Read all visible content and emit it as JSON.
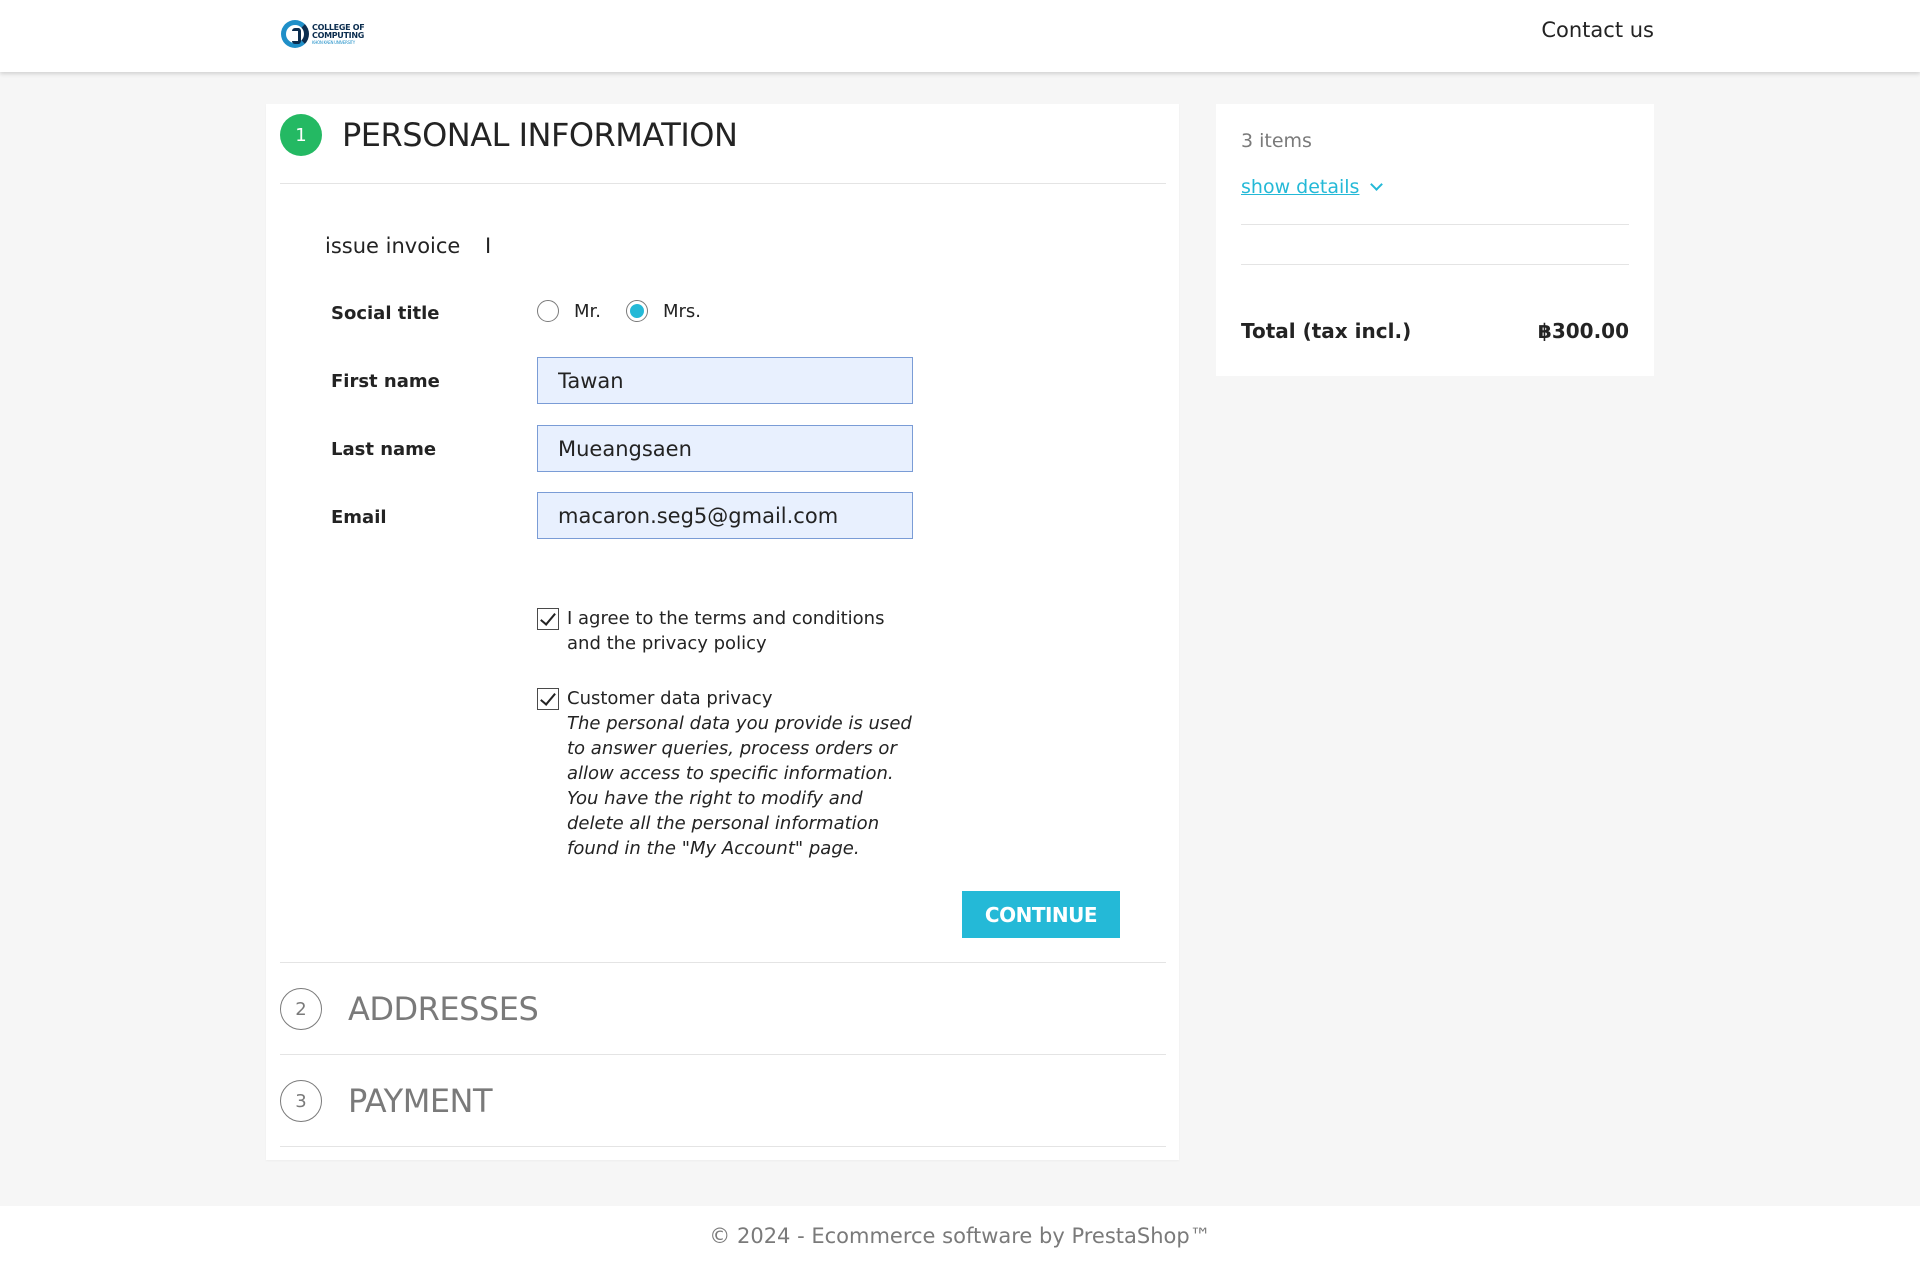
{
  "header": {
    "logo": {
      "line1": "COLLEGE OF",
      "line2": "COMPUTING",
      "line3": "KHON KAEN UNIVERSITY"
    },
    "contact_label": "Contact us"
  },
  "checkout": {
    "steps": [
      {
        "number": "1",
        "title": "PERSONAL INFORMATION",
        "state": "active"
      },
      {
        "number": "2",
        "title": "ADDRESSES",
        "state": "inactive"
      },
      {
        "number": "3",
        "title": "PAYMENT",
        "state": "inactive"
      }
    ],
    "invoice_label": "issue invoice",
    "invoice_marker": "I",
    "social_title": {
      "label": "Social title",
      "options": [
        "Mr.",
        "Mrs."
      ],
      "selected": "Mrs."
    },
    "first_name": {
      "label": "First name",
      "value": "Tawan"
    },
    "last_name": {
      "label": "Last name",
      "value": "Mueangsaen"
    },
    "email": {
      "label": "Email",
      "value": "macaron.seg5@gmail.com"
    },
    "terms": {
      "checked": true,
      "label": "I agree to the terms and conditions and the privacy policy"
    },
    "privacy": {
      "checked": true,
      "label": "Customer data privacy",
      "description": "The personal data you provide is used to answer queries, process orders or allow access to specific information. You have the right to modify and delete all the personal information found in the \"My Account\" page."
    },
    "continue_label": "CONTINUE"
  },
  "summary": {
    "items_count": "3 items",
    "show_details_label": "show details",
    "total_label": "Total (tax incl.)",
    "total_value": "฿300.00"
  },
  "footer": {
    "text": "© 2024 - Ecommerce software by PrestaShop™"
  },
  "colors": {
    "accent": "#24b9d7",
    "active_step": "#24b963",
    "autofill_bg": "#e8f0fe"
  }
}
